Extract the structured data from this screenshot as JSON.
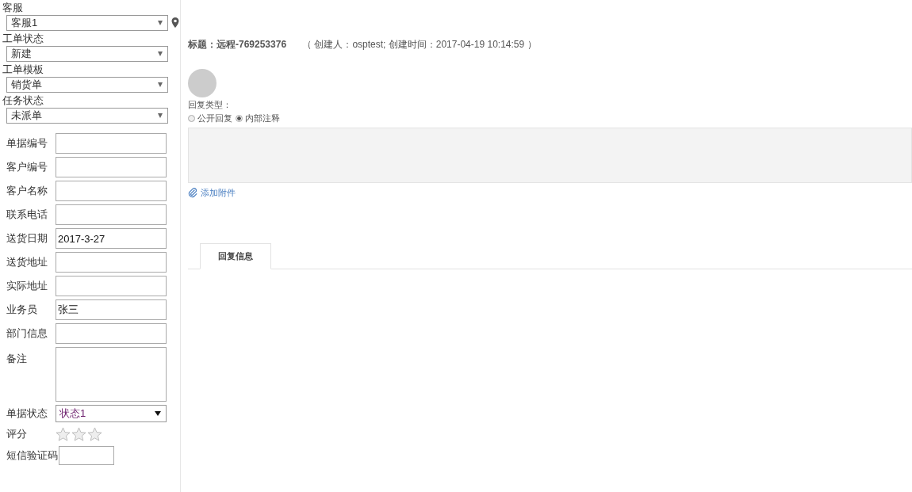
{
  "top_fields": [
    {
      "label": "客服",
      "value": "客服1",
      "pin": true
    },
    {
      "label": "工单状态",
      "value": "新建",
      "pin": false
    },
    {
      "label": "工单模板",
      "value": "销货单",
      "pin": false
    },
    {
      "label": "任务状态",
      "value": "未派单",
      "pin": false
    }
  ],
  "form_rows": [
    {
      "kind": "input",
      "label": "单据编号"
    },
    {
      "kind": "input",
      "label": "客户编号"
    },
    {
      "kind": "input",
      "label": "客户名称"
    },
    {
      "kind": "input",
      "label": "联系电话"
    },
    {
      "kind": "input",
      "label": "送货日期",
      "value": "2017-3-27"
    },
    {
      "kind": "input",
      "label": "送货地址"
    },
    {
      "kind": "input",
      "label": "实际地址"
    },
    {
      "kind": "input",
      "label": "业务员",
      "value": "张三"
    },
    {
      "kind": "input",
      "label": "部门信息"
    },
    {
      "kind": "textarea",
      "label": "备注"
    },
    {
      "kind": "select",
      "label": "单据状态",
      "value": "状态1"
    },
    {
      "kind": "stars",
      "label": "评分",
      "stars": 0
    },
    {
      "kind": "short",
      "label": "短信验证码"
    }
  ],
  "ticket": {
    "title": "标题：远程-769253376",
    "meta": "（ 创建人：osptest;  创建时间：2017-04-19 10:14:59 ）"
  },
  "reply": {
    "type_label": "回复类型：",
    "options": [
      {
        "label": "公开回复",
        "selected": false
      },
      {
        "label": "内部注释",
        "selected": true
      }
    ],
    "attach": "添加附件"
  },
  "tabs": [
    {
      "label": "回复信息",
      "selected": true
    }
  ]
}
